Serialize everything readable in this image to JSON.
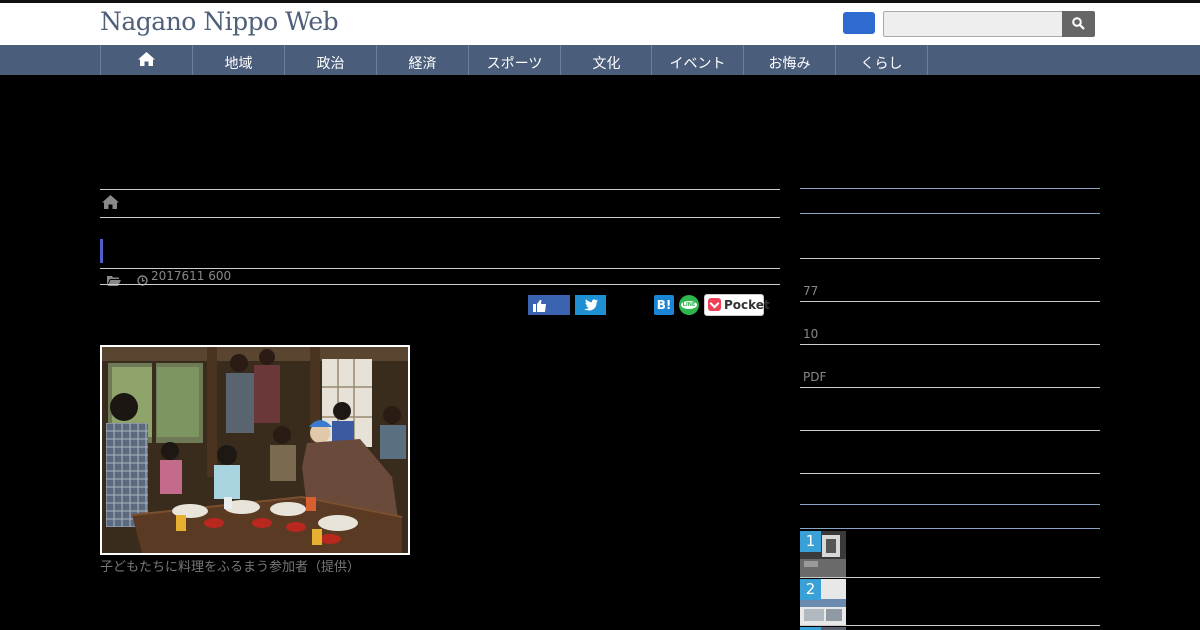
{
  "header": {
    "site_title": "Nagano Nippo Web",
    "search_placeholder": "",
    "search_button_icon": "search-icon"
  },
  "nav": {
    "home_icon": "home-icon",
    "items": [
      "地域",
      "政治",
      "経済",
      "スポーツ",
      "文化",
      "イベント",
      "お悔み",
      "くらし"
    ]
  },
  "article": {
    "breadcrumb_icon": "home-icon",
    "title": "",
    "date": "2017611 600",
    "category_icon": "folder-icon",
    "time_icon": "clock-icon",
    "share": {
      "facebook_icon": "thumbs-up-icon",
      "twitter_icon": "twitter-bird-icon",
      "hatena_label": "B!",
      "line_label": "LINE",
      "pocket_label": "Pocket"
    },
    "photo_caption": "子どもたちに料理をふるまう参加者（提供）"
  },
  "sidebar": {
    "texts": [
      "77",
      "10",
      "PDF"
    ],
    "ranking": [
      {
        "rank": "1"
      },
      {
        "rank": "2"
      }
    ]
  },
  "colors": {
    "nav_bg": "#4a5d7a",
    "title_accent": "#4f5fc9",
    "brand_text": "#50607a",
    "rank_badge": "#3aa0d8"
  }
}
